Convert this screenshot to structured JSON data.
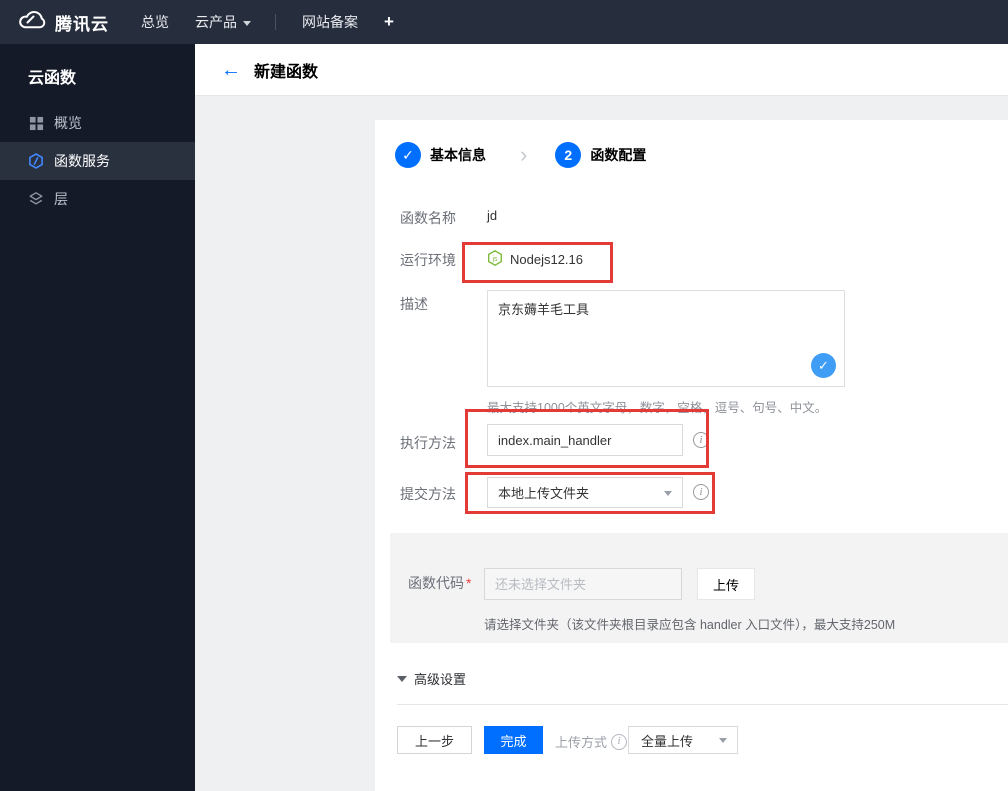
{
  "topnav": {
    "brand": "腾讯云",
    "overview": "总览",
    "products": "云产品",
    "icp": "网站备案",
    "add": "+"
  },
  "sidebar": {
    "title": "云函数",
    "items": [
      {
        "label": "概览",
        "icon": "grid-icon",
        "active": false
      },
      {
        "label": "函数服务",
        "icon": "scf-hexagon-icon",
        "active": true
      },
      {
        "label": "层",
        "icon": "layers-icon",
        "active": false
      }
    ]
  },
  "header": {
    "back": "←",
    "title": "新建函数"
  },
  "steps": {
    "done_glyph": "✓",
    "step1_label": "基本信息",
    "separator": "›",
    "step2_number": "2",
    "step2_label": "函数配置"
  },
  "form": {
    "name_label": "函数名称",
    "name_value": "jd",
    "runtime_label": "运行环境",
    "runtime_value": "Nodejs12.16",
    "node_glyph": "js",
    "desc_label": "描述",
    "desc_value": "京东薅羊毛工具",
    "desc_check_glyph": "✓",
    "desc_hint": "最大支持1000个英文字母，数字，空格，逗号、句号、中文。",
    "handler_label": "执行方法",
    "handler_value": "index.main_handler",
    "submit_label": "提交方法",
    "submit_value": "本地上传文件夹",
    "info_glyph": "i"
  },
  "code_section": {
    "label": "函数代码",
    "required_mark": "*",
    "placeholder": "还未选择文件夹",
    "upload_button": "上传",
    "hint": "请选择文件夹（该文件夹根目录应包含 handler 入口文件），最大支持250M"
  },
  "advanced": {
    "label": "高级设置"
  },
  "footer": {
    "prev_button": "上一步",
    "finish_button": "完成",
    "upload_mode_label": "上传方式",
    "upload_mode_value": "全量上传"
  },
  "colors": {
    "primary_blue": "#006eff",
    "annotation_red": "#e23a36",
    "node_green": "#7fba3f",
    "check_blue": "#3f9df5",
    "topnav_bg": "#262e3d",
    "sidebar_bg": "#141a28"
  }
}
